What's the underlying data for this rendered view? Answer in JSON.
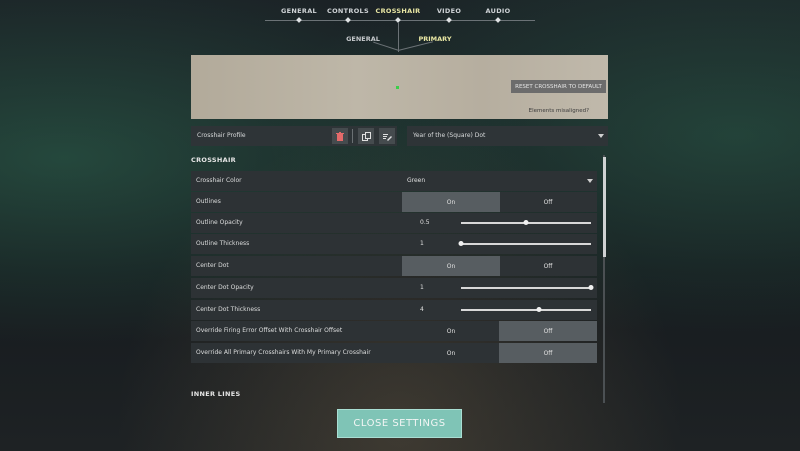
{
  "top_tabs": [
    "GENERAL",
    "CONTROLS",
    "CROSSHAIR",
    "VIDEO",
    "AUDIO"
  ],
  "active_top_tab": "CROSSHAIR",
  "sub_tabs": [
    "GENERAL",
    "PRIMARY"
  ],
  "active_sub_tab": "PRIMARY",
  "preview": {
    "reset_label": "RESET CROSSHAIR TO DEFAULT",
    "misaligned_label": "Elements misaligned?",
    "crosshair_color": "#3ccf4a"
  },
  "profile": {
    "label": "Crosshair Profile",
    "selected": "Year of the (Square) Dot",
    "icons": [
      "trash-icon",
      "copy-icon",
      "edit-icon"
    ]
  },
  "sections": {
    "crosshair": "CROSSHAIR",
    "inner_lines": "INNER LINES"
  },
  "settings": {
    "crosshair_color": {
      "label": "Crosshair Color",
      "value": "Green"
    },
    "outlines": {
      "label": "Outlines",
      "on": "On",
      "off": "Off",
      "selected": "On"
    },
    "outline_opacity": {
      "label": "Outline Opacity",
      "value": "0.5",
      "fraction": 0.5
    },
    "outline_thickness": {
      "label": "Outline Thickness",
      "value": "1",
      "fraction": 0.0
    },
    "center_dot": {
      "label": "Center Dot",
      "on": "On",
      "off": "Off",
      "selected": "On"
    },
    "center_dot_opacity": {
      "label": "Center Dot Opacity",
      "value": "1",
      "fraction": 1.0
    },
    "center_dot_thickness": {
      "label": "Center Dot Thickness",
      "value": "4",
      "fraction": 0.6
    },
    "override_firing": {
      "label": "Override Firing Error Offset With Crosshair Offset",
      "on": "On",
      "off": "Off",
      "selected": "Off"
    },
    "override_all": {
      "label": "Override All Primary Crosshairs With My Primary Crosshair",
      "on": "On",
      "off": "Off",
      "selected": "Off"
    }
  },
  "close_label": "CLOSE SETTINGS",
  "colors": {
    "accent": "#e9e7a4",
    "close_button": "#7fc4b6"
  }
}
